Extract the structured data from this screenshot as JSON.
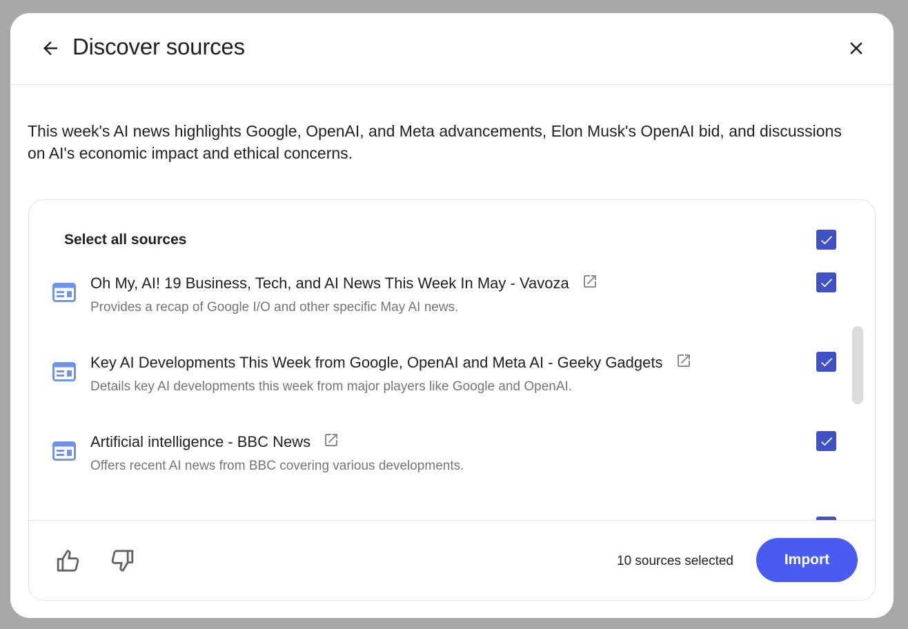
{
  "header": {
    "title": "Discover sources",
    "back_icon": "arrow-left-icon",
    "close_icon": "close-icon"
  },
  "summary": "This week's AI news highlights Google, OpenAI, and Meta advancements, Elon Musk's OpenAI bid, and discussions on AI's economic impact and ethical concerns.",
  "select_all": {
    "label": "Select all sources",
    "checked": true
  },
  "sources": [
    {
      "title": "Oh My, AI! 19 Business, Tech, and AI News This Week In May - Vavoza",
      "description": "Provides a recap of Google I/O and other specific May AI news.",
      "checked": true,
      "icon": "web-page-icon"
    },
    {
      "title": "Key AI Developments This Week from Google, OpenAI and Meta AI - Geeky Gadgets",
      "description": "Details key AI developments this week from major players like Google and OpenAI.",
      "checked": true,
      "icon": "web-page-icon"
    },
    {
      "title": "Artificial intelligence - BBC News",
      "description": "Offers recent AI news from BBC covering various developments.",
      "checked": true,
      "icon": "web-page-icon"
    }
  ],
  "footer": {
    "selected_count": "10 sources selected",
    "import_label": "Import",
    "thumbs_up_icon": "thumbs-up-icon",
    "thumbs_down_icon": "thumbs-down-icon"
  },
  "colors": {
    "accent": "#4a5cf0",
    "checkbox": "#3f51c6",
    "doc_icon": "#6f93e8",
    "muted_text": "#757575"
  }
}
